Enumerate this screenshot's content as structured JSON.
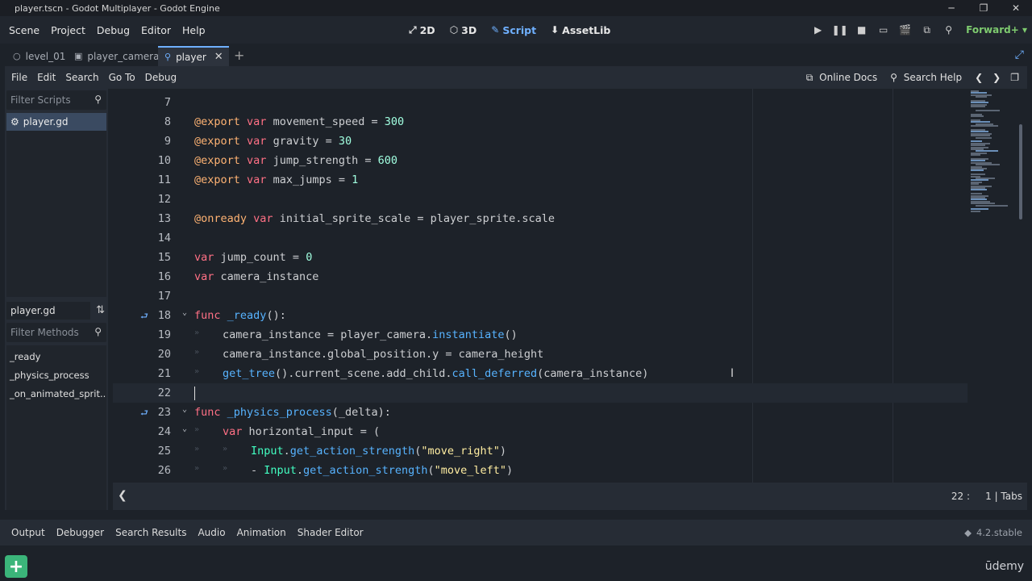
{
  "window": {
    "title": "player.tscn - Godot Multiplayer - Godot Engine"
  },
  "main_menu": [
    "Scene",
    "Project",
    "Debug",
    "Editor",
    "Help"
  ],
  "workspaces": [
    {
      "label": "2D",
      "icon": "2d-icon"
    },
    {
      "label": "3D",
      "icon": "3d-icon"
    },
    {
      "label": "Script",
      "icon": "script-icon",
      "active": true
    },
    {
      "label": "AssetLib",
      "icon": "assetlib-icon"
    }
  ],
  "renderer": "Forward+",
  "scene_tabs": [
    {
      "label": "level_01",
      "icon": "node2d-icon"
    },
    {
      "label": "player_camera",
      "icon": "camera-icon"
    },
    {
      "label": "player",
      "icon": "node-icon",
      "active": true
    }
  ],
  "script_menu": [
    "File",
    "Edit",
    "Search",
    "Go To",
    "Debug"
  ],
  "script_menu_right": {
    "online_docs": "Online Docs",
    "search_help": "Search Help"
  },
  "scripts_panel": {
    "filter_placeholder": "Filter Scripts",
    "scripts": [
      "player.gd"
    ],
    "current_script": "player.gd",
    "methods_filter_placeholder": "Filter Methods",
    "methods": [
      "_ready",
      "_physics_process",
      "_on_animated_sprit..."
    ]
  },
  "code_lines": [
    {
      "n": "7",
      "segs": []
    },
    {
      "n": "8",
      "segs": [
        [
          "ann",
          "@export"
        ],
        [
          "",
          " "
        ],
        [
          "kw",
          "var"
        ],
        [
          "",
          " movement_speed = "
        ],
        [
          "num",
          "300"
        ]
      ]
    },
    {
      "n": "9",
      "segs": [
        [
          "ann",
          "@export"
        ],
        [
          "",
          " "
        ],
        [
          "kw",
          "var"
        ],
        [
          "",
          " gravity = "
        ],
        [
          "num",
          "30"
        ]
      ]
    },
    {
      "n": "10",
      "segs": [
        [
          "ann",
          "@export"
        ],
        [
          "",
          " "
        ],
        [
          "kw",
          "var"
        ],
        [
          "",
          " jump_strength = "
        ],
        [
          "num",
          "600"
        ]
      ]
    },
    {
      "n": "11",
      "segs": [
        [
          "ann",
          "@export"
        ],
        [
          "",
          " "
        ],
        [
          "kw",
          "var"
        ],
        [
          "",
          " max_jumps = "
        ],
        [
          "num",
          "1"
        ]
      ]
    },
    {
      "n": "12",
      "segs": []
    },
    {
      "n": "13",
      "segs": [
        [
          "ann",
          "@onready"
        ],
        [
          "",
          " "
        ],
        [
          "kw",
          "var"
        ],
        [
          "",
          " initial_sprite_scale = player_sprite.scale"
        ]
      ]
    },
    {
      "n": "14",
      "segs": []
    },
    {
      "n": "15",
      "segs": [
        [
          "kw",
          "var"
        ],
        [
          "",
          " jump_count = "
        ],
        [
          "num",
          "0"
        ]
      ]
    },
    {
      "n": "16",
      "segs": [
        [
          "kw",
          "var"
        ],
        [
          "",
          " camera_instance"
        ]
      ]
    },
    {
      "n": "17",
      "segs": []
    },
    {
      "n": "18",
      "segs": [
        [
          "kw",
          "func"
        ],
        [
          "",
          " "
        ],
        [
          "fn",
          "_ready"
        ],
        [
          "",
          "():"
        ]
      ],
      "fold": true,
      "gutter": true
    },
    {
      "n": "19",
      "indent": 1,
      "segs": [
        [
          "",
          "camera_instance = player_camera."
        ],
        [
          "fn",
          "instantiate"
        ],
        [
          "",
          "()"
        ]
      ]
    },
    {
      "n": "20",
      "indent": 1,
      "segs": [
        [
          "",
          "camera_instance.global_position.y = camera_height"
        ]
      ]
    },
    {
      "n": "21",
      "indent": 1,
      "segs": [
        [
          "fn",
          "get_tree"
        ],
        [
          "",
          "().current_scene.add_child."
        ],
        [
          "fn",
          "call_deferred"
        ],
        [
          "",
          "(camera_instance)"
        ]
      ]
    },
    {
      "n": "22",
      "segs": [],
      "current": true
    },
    {
      "n": "23",
      "segs": [
        [
          "kw",
          "func"
        ],
        [
          "",
          " "
        ],
        [
          "fn",
          "_physics_process"
        ],
        [
          "",
          "(_delta):"
        ]
      ],
      "fold": true,
      "gutter": true
    },
    {
      "n": "24",
      "indent": 1,
      "segs": [
        [
          "kw",
          "var"
        ],
        [
          "",
          " horizontal_input = ("
        ]
      ],
      "fold": true
    },
    {
      "n": "25",
      "indent": 2,
      "segs": [
        [
          "cls",
          "Input"
        ],
        [
          "",
          "."
        ],
        [
          "fn",
          "get_action_strength"
        ],
        [
          "",
          "("
        ],
        [
          "str",
          "\"move_right\""
        ],
        [
          "",
          ")"
        ]
      ]
    },
    {
      "n": "26",
      "indent": 2,
      "segs": [
        [
          "",
          "- "
        ],
        [
          "cls",
          "Input"
        ],
        [
          "",
          "."
        ],
        [
          "fn",
          "get_action_strength"
        ],
        [
          "",
          "("
        ],
        [
          "str",
          "\"move_left\""
        ],
        [
          "",
          ")"
        ]
      ]
    }
  ],
  "status": {
    "line": "22",
    "col": "1",
    "indent_mode": "Tabs"
  },
  "bottom_tabs": [
    "Output",
    "Debugger",
    "Search Results",
    "Audio",
    "Animation",
    "Shader Editor"
  ],
  "version": "4.2.stable",
  "brand": "ūdemy"
}
